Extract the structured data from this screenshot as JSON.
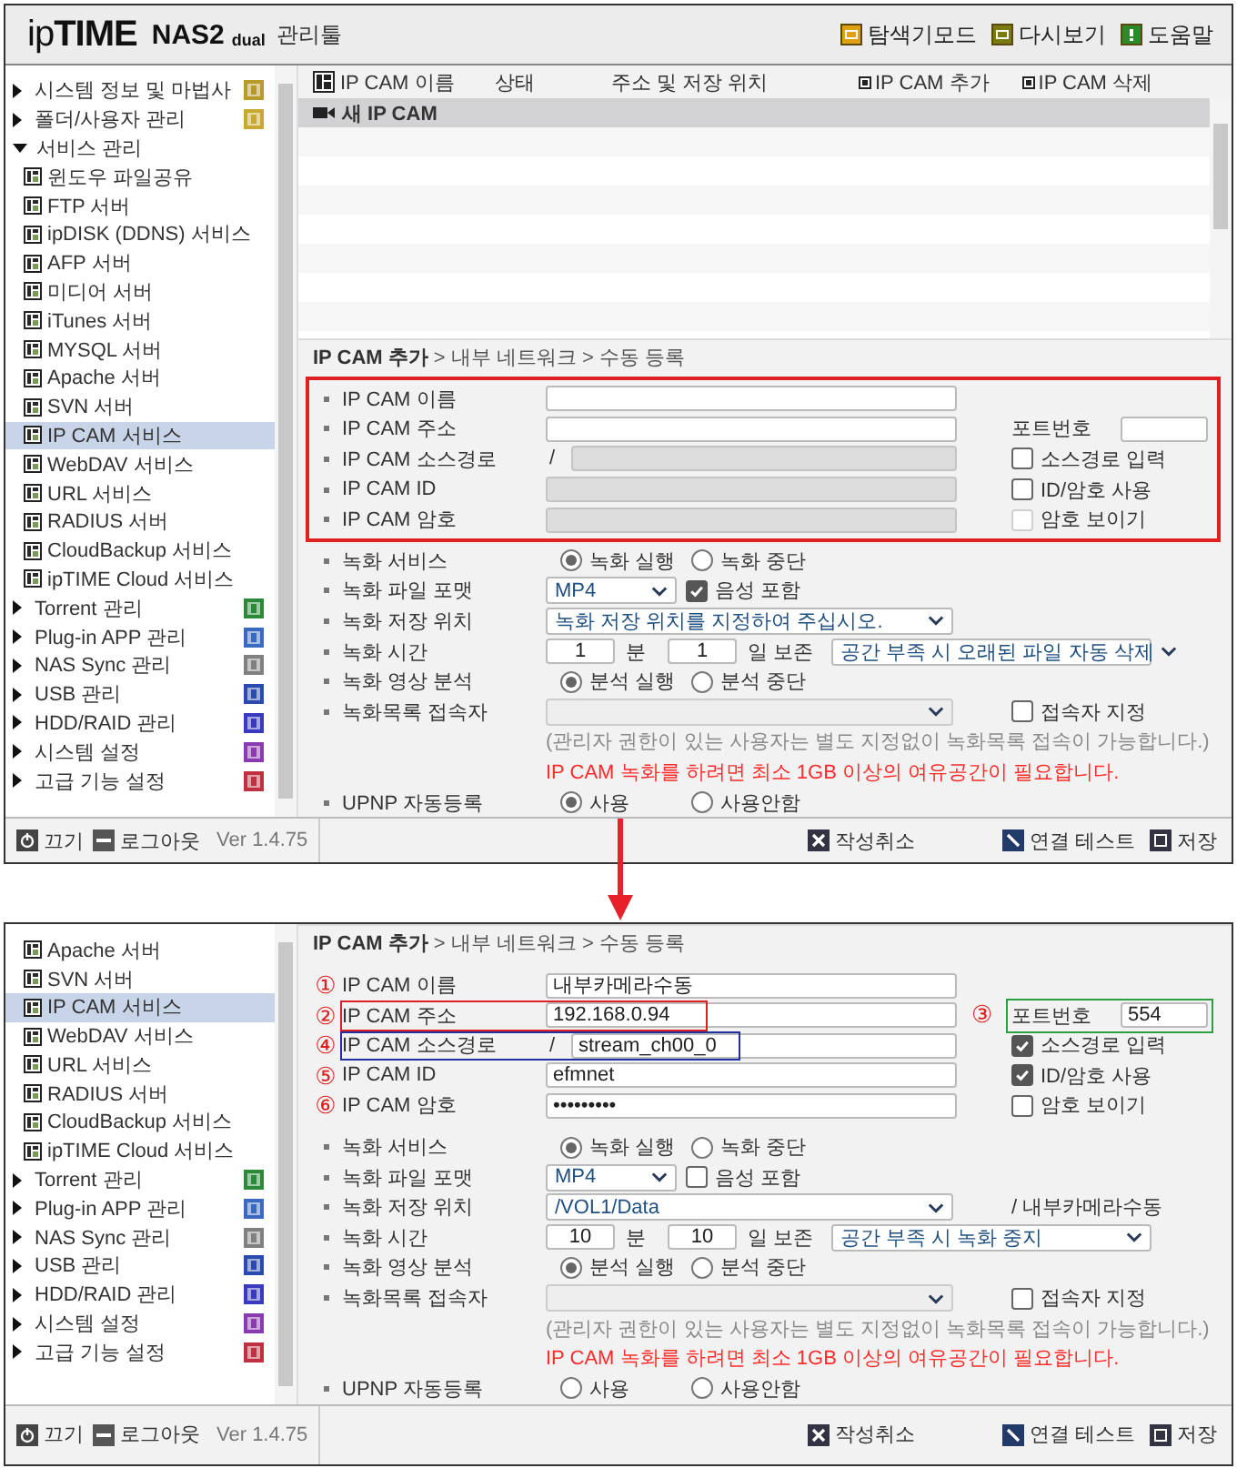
{
  "panels": [
    {
      "header": {
        "brand": "ip**TIME**",
        "product": "NAS2",
        "edition": "dual",
        "title": "관리툴",
        "actions": [
          {
            "kind": "explorer",
            "label": "탐색기모드"
          },
          {
            "kind": "replay",
            "label": "다시보기"
          },
          {
            "kind": "help",
            "label": "도움말"
          }
        ]
      },
      "sidebar": {
        "items": [
          {
            "label": "시스템 정보 및 마법사",
            "expanded": false,
            "color": "#b89a2a"
          },
          {
            "label": "폴더/사용자 관리",
            "expanded": false,
            "color": "#c8a830"
          },
          {
            "label": "서비스 관리",
            "expanded": true,
            "children": [
              {
                "label": "윈도우 파일공유",
                "selected": false
              },
              {
                "label": "FTP 서버",
                "selected": false
              },
              {
                "label": "ipDISK (DDNS) 서비스",
                "selected": false
              },
              {
                "label": "AFP 서버",
                "selected": false
              },
              {
                "label": "미디어 서버",
                "selected": false
              },
              {
                "label": "iTunes 서버",
                "selected": false
              },
              {
                "label": "MYSQL 서버",
                "selected": false
              },
              {
                "label": "Apache 서버",
                "selected": false
              },
              {
                "label": "SVN 서버",
                "selected": false
              },
              {
                "label": "IP CAM 서비스",
                "selected": true
              },
              {
                "label": "WebDAV 서비스",
                "selected": false
              },
              {
                "label": "URL 서비스",
                "selected": false
              },
              {
                "label": "RADIUS 서버",
                "selected": false
              },
              {
                "label": "CloudBackup 서비스",
                "selected": false
              },
              {
                "label": "ipTIME Cloud 서비스",
                "selected": false
              }
            ]
          },
          {
            "label": "Torrent 관리",
            "expanded": false,
            "color": "#2a8a3a"
          },
          {
            "label": "Plug-in APP 관리",
            "expanded": false,
            "color": "#3a6ac0"
          },
          {
            "label": "NAS Sync 관리",
            "expanded": false,
            "color": "#808080"
          },
          {
            "label": "USB 관리",
            "expanded": false,
            "color": "#2a4ab0"
          },
          {
            "label": "HDD/RAID 관리",
            "expanded": false,
            "color": "#3a3ac0"
          },
          {
            "label": "시스템 설정",
            "expanded": false,
            "color": "#8a3ab0"
          },
          {
            "label": "고급 기능 설정",
            "expanded": false,
            "color": "#c03040"
          }
        ]
      },
      "camera_list": {
        "columns": [
          "IP CAM 이름",
          "상태",
          "주소 및 저장 위치"
        ],
        "buttons": [
          "IP CAM 추가",
          "IP CAM 삭제"
        ],
        "rows": [
          {
            "name": "새 IP CAM",
            "selected": true
          }
        ]
      },
      "breadcrumb": "**IP CAM 추가** > 내부 네트워크 > 수동 등록",
      "camera_form": {
        "framed": true,
        "fields": [
          {
            "label": "IP CAM 이름",
            "disabled": false
          },
          {
            "label": "IP CAM 주소",
            "disabled": false,
            "side": {
              "kind": "port",
              "label": "포트번호"
            }
          },
          {
            "label": "IP CAM 소스경로",
            "prefix": "/",
            "disabled": true,
            "side": {
              "kind": "checkbox",
              "label": "소스경로 입력",
              "checked": false,
              "disabled": false
            }
          },
          {
            "label": "IP CAM ID",
            "disabled": true,
            "side": {
              "kind": "checkbox",
              "label": "ID/암호 사용",
              "checked": false,
              "disabled": false
            }
          },
          {
            "label": "IP CAM 암호",
            "disabled": true,
            "side": {
              "kind": "checkbox",
              "label": "암호 보이기",
              "checked": false,
              "disabled": true
            }
          }
        ]
      },
      "settings": [
        {
          "kind": "setting",
          "label": "녹화 서비스",
          "controls": [
            {
              "kind": "radio",
              "label": "녹화 실행",
              "selected": true
            },
            {
              "kind": "radio",
              "label": "녹화 중단",
              "selected": false
            }
          ]
        },
        {
          "kind": "setting",
          "label": "녹화 파일 포맷",
          "controls": [
            {
              "kind": "dropdown",
              "value": "MP4",
              "disabled": false
            },
            {
              "kind": "checkbox",
              "label": "음성 포함",
              "checked": true
            }
          ]
        },
        {
          "kind": "setting",
          "label": "녹화 저장 위치",
          "controls": [
            {
              "kind": "wide-dropdown",
              "value": "녹화 저장 위치를 지정하여 주십시오.",
              "disabled": false
            }
          ]
        },
        {
          "kind": "setting",
          "label": "녹화 시간",
          "controls": [
            {
              "kind": "number",
              "value": "1"
            },
            {
              "kind": "unit",
              "text": "분"
            },
            {
              "kind": "number",
              "value": "1"
            },
            {
              "kind": "unit",
              "text": "일 보존"
            },
            {
              "kind": "policy-dropdown",
              "value": "공간 부족 시 오래된 파일 자동 삭제",
              "disabled": false
            }
          ]
        },
        {
          "kind": "setting",
          "label": "녹화 영상 분석",
          "controls": [
            {
              "kind": "radio",
              "label": "분석 실행",
              "selected": true
            },
            {
              "kind": "radio",
              "label": "분석 중단",
              "selected": false
            }
          ]
        },
        {
          "kind": "setting",
          "label": "녹화목록 접속자",
          "controls": [
            {
              "kind": "wide-dropdown",
              "disabled": true
            }
          ],
          "side": [
            {
              "kind": "checkbox",
              "label": "접속자 지정",
              "checked": false
            }
          ]
        },
        {
          "kind": "note",
          "text": "(관리자 권한이 있는 사용자는 별도 지정없이 녹화목록 접속이 가능합니다.)",
          "color": "#8a8a8a"
        },
        {
          "kind": "note",
          "text": "IP CAM 녹화를 하려면 최소 1GB 이상의 여유공간이 필요합니다.",
          "color": "#ff2a2a"
        },
        {
          "kind": "setting",
          "label": "UPNP 자동등록",
          "controls": [
            {
              "kind": "radio",
              "label": "사용",
              "selected": true
            },
            {
              "kind": "radio",
              "label": "사용안함",
              "selected": false
            }
          ]
        }
      ],
      "footer": {
        "left": [
          {
            "kind": "power",
            "label": "끄기"
          },
          {
            "kind": "logout",
            "label": "로그아웃"
          }
        ],
        "version": "Ver 1.4.75",
        "right": [
          {
            "kind": "cancel",
            "label": "작성취소"
          },
          {
            "kind": "test",
            "label": "연결 테스트"
          },
          {
            "kind": "save",
            "label": "저장"
          }
        ]
      }
    },
    {
      "sidebar": {
        "items": [
          {
            "children": [
              {
                "label": "Apache 서버",
                "selected": false
              },
              {
                "label": "SVN 서버",
                "selected": false
              },
              {
                "label": "IP CAM 서비스",
                "selected": true
              },
              {
                "label": "WebDAV 서비스",
                "selected": false
              },
              {
                "label": "URL 서비스",
                "selected": false
              },
              {
                "label": "RADIUS 서버",
                "selected": false
              },
              {
                "label": "CloudBackup 서비스",
                "selected": false
              },
              {
                "label": "ipTIME Cloud 서비스",
                "selected": false
              }
            ]
          },
          {
            "label": "Torrent 관리",
            "expanded": false,
            "color": "#2a8a3a"
          },
          {
            "label": "Plug-in APP 관리",
            "expanded": false,
            "color": "#3a6ac0"
          },
          {
            "label": "NAS Sync 관리",
            "expanded": false,
            "color": "#808080"
          },
          {
            "label": "USB 관리",
            "expanded": false,
            "color": "#2a4ab0"
          },
          {
            "label": "HDD/RAID 관리",
            "expanded": false,
            "color": "#3a3ac0"
          },
          {
            "label": "시스템 설정",
            "expanded": false,
            "color": "#8a3ab0"
          },
          {
            "label": "고급 기능 설정",
            "expanded": false,
            "color": "#c03040"
          }
        ]
      },
      "breadcrumb": "**IP CAM 추가** > 내부 네트워크 > 수동 등록",
      "camera_form": {
        "fields": [
          {
            "marker": "①",
            "label": "IP CAM 이름",
            "value": "내부카메라수동",
            "disabled": false
          },
          {
            "marker": "②",
            "label": "IP CAM 주소",
            "value": "192.168.0.94",
            "disabled": false,
            "color": "#e02020",
            "side": {
              "kind": "port",
              "marker": "③",
              "label": "포트번호",
              "value": "554",
              "color": "#2aa040"
            }
          },
          {
            "marker": "④",
            "label": "IP CAM 소스경로",
            "prefix": "/",
            "value": "stream_ch00_0",
            "disabled": false,
            "color": "#2030a0",
            "side": {
              "kind": "checkbox",
              "label": "소스경로 입력",
              "checked": true,
              "disabled": false
            }
          },
          {
            "marker": "⑤",
            "label": "IP CAM ID",
            "value": "efmnet",
            "disabled": false,
            "side": {
              "kind": "checkbox",
              "label": "ID/암호 사용",
              "checked": true,
              "disabled": false
            }
          },
          {
            "marker": "⑥",
            "label": "IP CAM 암호",
            "value": "•••••••••",
            "disabled": false,
            "side": {
              "kind": "checkbox",
              "label": "암호 보이기",
              "checked": false,
              "disabled": false
            }
          }
        ]
      },
      "settings": [
        {
          "kind": "setting",
          "label": "녹화 서비스",
          "controls": [
            {
              "kind": "radio",
              "label": "녹화 실행",
              "selected": true
            },
            {
              "kind": "radio",
              "label": "녹화 중단",
              "selected": false
            }
          ]
        },
        {
          "kind": "setting",
          "label": "녹화 파일 포맷",
          "controls": [
            {
              "kind": "dropdown",
              "value": "MP4",
              "disabled": false
            },
            {
              "kind": "checkbox",
              "label": "음성 포함",
              "checked": false
            }
          ]
        },
        {
          "kind": "setting",
          "label": "녹화 저장 위치",
          "controls": [
            {
              "kind": "wide-dropdown",
              "value": "/VOL1/Data",
              "disabled": false
            }
          ],
          "side": [
            {
              "kind": "text",
              "text": "/ 내부카메라수동"
            }
          ]
        },
        {
          "kind": "setting",
          "label": "녹화 시간",
          "controls": [
            {
              "kind": "number",
              "value": "10"
            },
            {
              "kind": "unit",
              "text": "분"
            },
            {
              "kind": "number",
              "value": "10"
            },
            {
              "kind": "unit",
              "text": "일 보존"
            },
            {
              "kind": "policy-dropdown",
              "value": "공간 부족 시 녹화 중지",
              "disabled": false
            }
          ]
        },
        {
          "kind": "setting",
          "label": "녹화 영상 분석",
          "controls": [
            {
              "kind": "radio",
              "label": "분석 실행",
              "selected": true
            },
            {
              "kind": "radio",
              "label": "분석 중단",
              "selected": false
            }
          ]
        },
        {
          "kind": "setting",
          "label": "녹화목록 접속자",
          "controls": [
            {
              "kind": "wide-dropdown",
              "disabled": true
            }
          ],
          "side": [
            {
              "kind": "checkbox",
              "label": "접속자 지정",
              "checked": false
            }
          ]
        },
        {
          "kind": "note",
          "text": "(관리자 권한이 있는 사용자는 별도 지정없이 녹화목록 접속이 가능합니다.)",
          "color": "#8a8a8a"
        },
        {
          "kind": "note",
          "text": "IP CAM 녹화를 하려면 최소 1GB 이상의 여유공간이 필요합니다.",
          "color": "#ff2a2a"
        },
        {
          "kind": "setting",
          "label": "UPNP 자동등록",
          "controls": [
            {
              "kind": "radio",
              "label": "사용",
              "selected": false
            },
            {
              "kind": "radio",
              "label": "사용안함",
              "selected": false
            }
          ]
        }
      ],
      "footer": {
        "left": [
          {
            "kind": "power",
            "label": "끄기"
          },
          {
            "kind": "logout",
            "label": "로그아웃"
          }
        ],
        "version": "Ver 1.4.75",
        "right": [
          {
            "kind": "cancel",
            "label": "작성취소"
          },
          {
            "kind": "test",
            "label": "연결 테스트"
          },
          {
            "kind": "save",
            "label": "저장"
          }
        ]
      }
    }
  ]
}
